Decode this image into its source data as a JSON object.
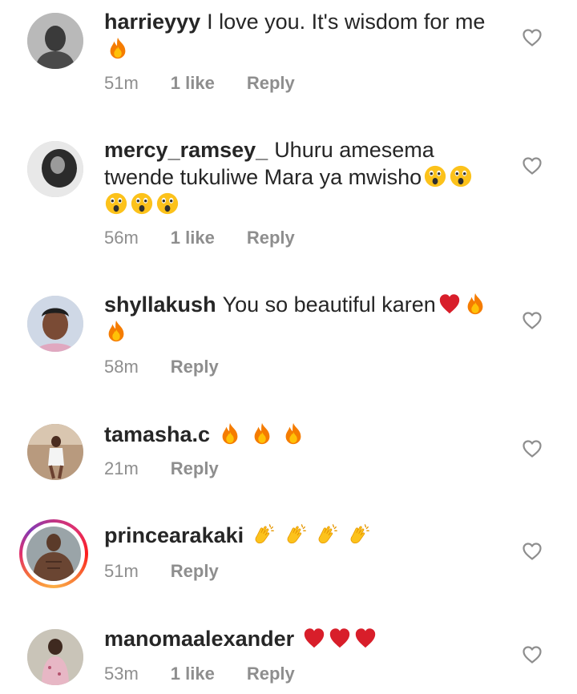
{
  "comments": [
    {
      "username": "harrieyyy",
      "text": "I love you. It's wisdom for me",
      "emojis": [
        "fire"
      ],
      "time": "51m",
      "likes": "1 like",
      "reply": "Reply"
    },
    {
      "username": "mercy_ramsey_",
      "text": "Uhuru amesema twende tukuliwe Mara ya mwisho",
      "emojis": [
        "astonished",
        "astonished",
        "astonished",
        "astonished",
        "astonished"
      ],
      "time": "56m",
      "likes": "1 like",
      "reply": "Reply"
    },
    {
      "username": "shyllakush",
      "text": "You so beautiful karen",
      "emojis": [
        "red-heart",
        "fire",
        "fire"
      ],
      "time": "58m",
      "likes": "",
      "reply": "Reply"
    },
    {
      "username": "tamasha.c",
      "text": "",
      "emojis": [
        "fire",
        "fire",
        "fire"
      ],
      "time": "21m",
      "likes": "",
      "reply": "Reply"
    },
    {
      "username": "princearakaki",
      "text": "",
      "emojis": [
        "clapping-hands",
        "clapping-hands",
        "clapping-hands",
        "clapping-hands"
      ],
      "time": "51m",
      "likes": "",
      "reply": "Reply"
    },
    {
      "username": "manomaalexander",
      "text": "",
      "emojis": [
        "red-heart",
        "red-heart",
        "red-heart"
      ],
      "time": "53m",
      "likes": "1 like",
      "reply": "Reply"
    }
  ],
  "colors": {
    "text": "#262626",
    "meta": "#8e8e8e",
    "heart_outline": "#8e8e8e"
  }
}
